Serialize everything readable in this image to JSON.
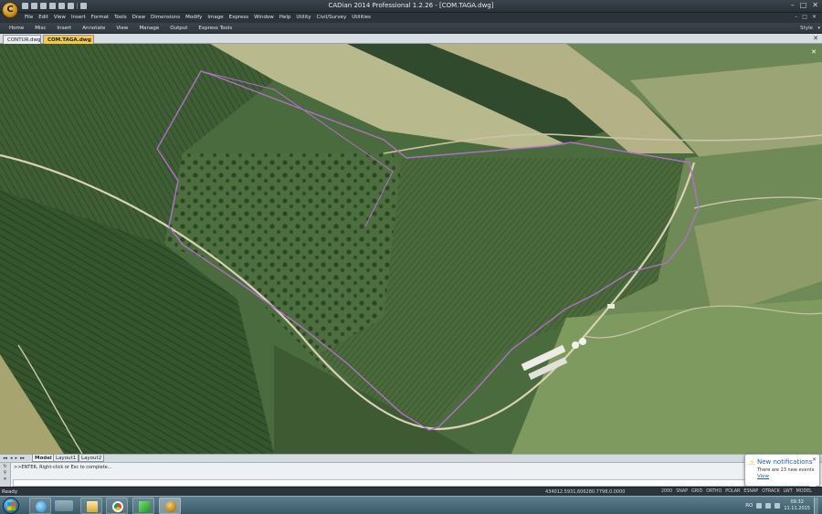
{
  "window": {
    "title": "CADian 2014 Professional 1.2.26 - [COM.TAGA.dwg]",
    "app_logo_letter": "C",
    "controls": [
      "–",
      "□",
      "✕"
    ]
  },
  "menu": {
    "items": [
      "File",
      "Edit",
      "View",
      "Insert",
      "Format",
      "Tools",
      "Draw",
      "Dimensions",
      "Modify",
      "Image",
      "Express",
      "Window",
      "Help",
      "Utility",
      "Civil/Survey",
      "Utilities"
    ],
    "mdi_controls": [
      "–",
      "□",
      "✕"
    ]
  },
  "ribbon": {
    "tabs": [
      "Home",
      "Misc",
      "Insert",
      "Annotate",
      "View",
      "Manage",
      "Output",
      "Express Tools"
    ],
    "style_label": "Style",
    "style_caret": "▾"
  },
  "documents": {
    "tabs": [
      "CONTUR.dwg",
      "COM.TAGA.dwg"
    ],
    "active": "COM.TAGA.dwg",
    "close": "✕"
  },
  "drawing": {
    "close": "✕",
    "boundary_color": "#b46ec8"
  },
  "layout_tabs": {
    "nav": [
      "◂◂",
      "◂",
      "▸",
      "▸▸"
    ],
    "tabs": [
      "Model",
      "Layout1",
      "Layout2"
    ],
    "active": "Model"
  },
  "command_line": {
    "side_icons": [
      "↻",
      "⚲",
      "✕"
    ],
    "history": ">>ENTER, Right-click or Esc to complete...",
    "input_value": ""
  },
  "notification": {
    "title": "New notifications",
    "text": "There are 23 new events",
    "link": "View",
    "close": "✕",
    "icon": "warning-icon"
  },
  "status": {
    "ready": "Ready",
    "coordinates": "434012.5931,606280.7798,0.0000",
    "toggles": [
      "2000",
      "SNAP",
      "GRID",
      "ORTHO",
      "POLAR",
      "ESNAP",
      "OTRACK",
      "LWT",
      "MODEL"
    ]
  },
  "taskbar": {
    "apps": [
      "start-icon",
      "internet-explorer-icon",
      "media-player-icon",
      "explorer-icon",
      "chrome-icon",
      "green-app-icon",
      "cadian-icon"
    ],
    "language": "RO",
    "time": "09:32",
    "date": "11.11.2015"
  },
  "colors": {
    "accent_tab": "#f5c84c",
    "title_bg": "#2a3138",
    "link": "#1f5fa8"
  }
}
